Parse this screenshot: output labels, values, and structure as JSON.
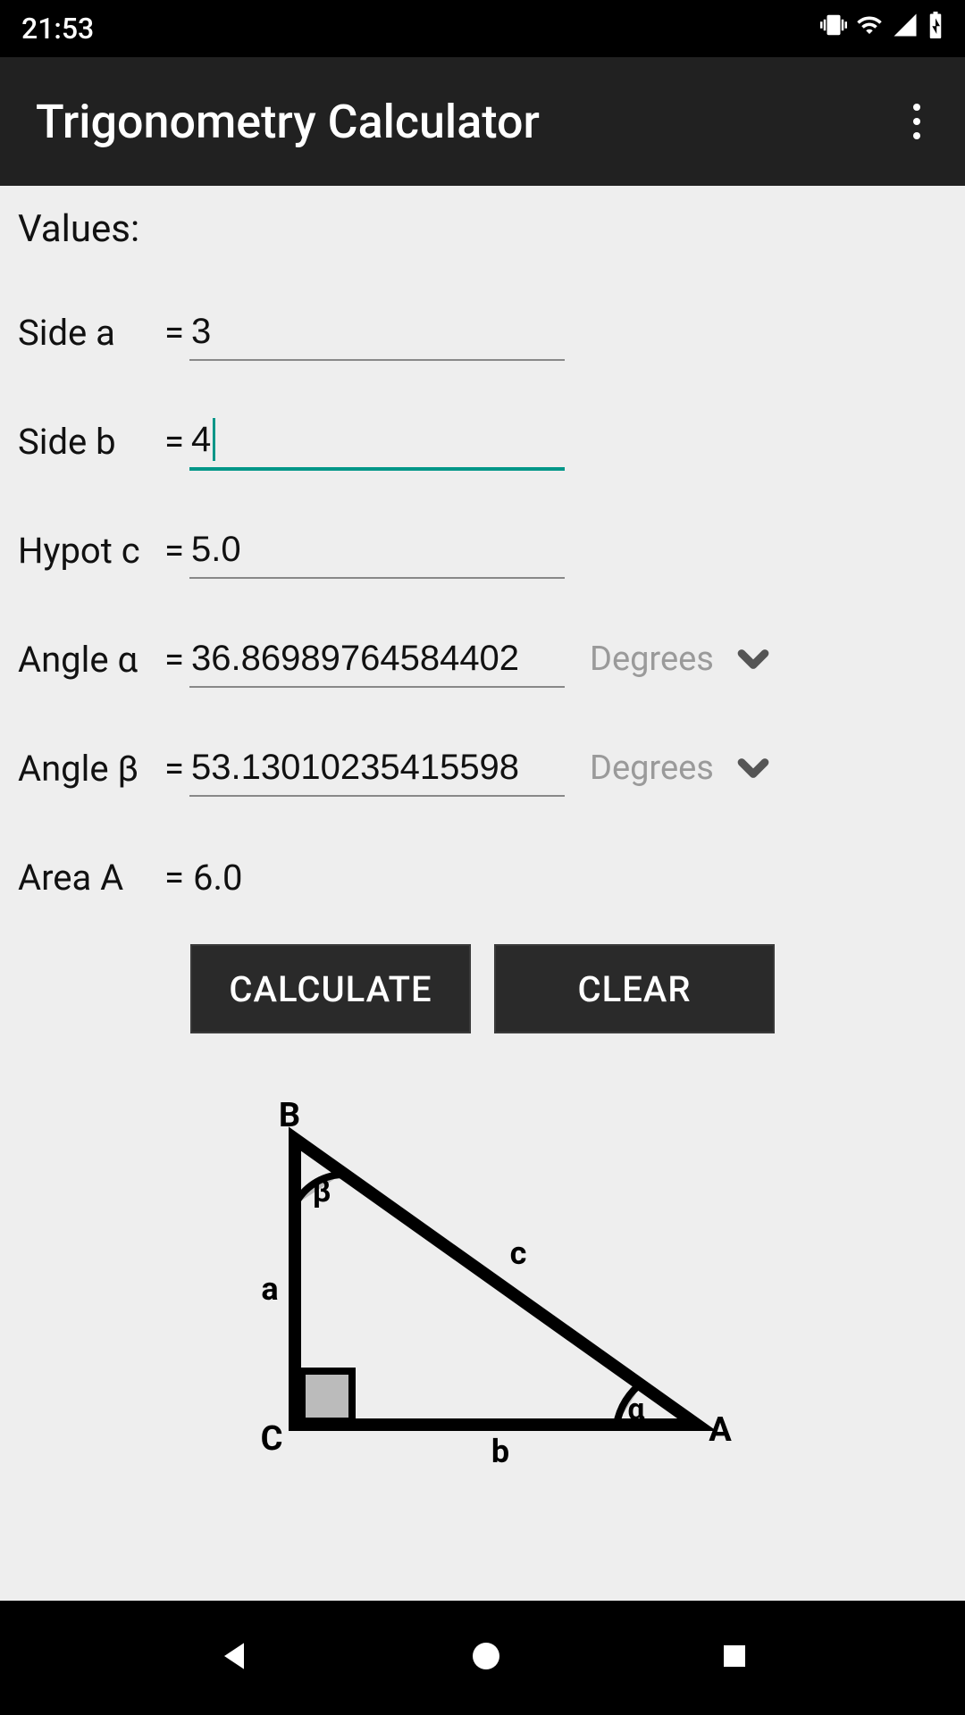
{
  "status": {
    "time": "21:53"
  },
  "header": {
    "title": "Trigonometry Calculator"
  },
  "section": {
    "values_label": "Values:"
  },
  "fields": {
    "side_a": {
      "label": "Side a",
      "value": "3"
    },
    "side_b": {
      "label": "Side b",
      "value": "4"
    },
    "hypot_c": {
      "label": "Hypot c",
      "value": "5.0"
    },
    "angle_a": {
      "label": "Angle α",
      "value": "36.86989764584402",
      "unit": "Degrees"
    },
    "angle_b": {
      "label": "Angle β",
      "value": "53.13010235415598",
      "unit": "Degrees"
    },
    "area": {
      "label": "Area A",
      "value": "6.0"
    }
  },
  "buttons": {
    "calculate": "CALCULATE",
    "clear": "CLEAR"
  },
  "equals": "=",
  "diagram": {
    "B": "B",
    "C": "C",
    "A": "A",
    "a": "a",
    "b": "b",
    "c": "c",
    "alpha": "α",
    "beta": "β"
  }
}
